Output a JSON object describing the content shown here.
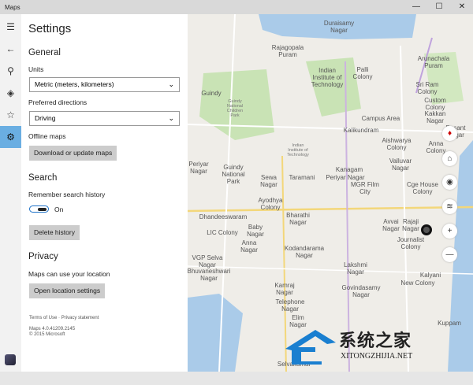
{
  "window": {
    "title": "Maps",
    "minimize": "—",
    "maximize": "☐",
    "close": "✕"
  },
  "rail": {
    "menu": "☰",
    "back": "←",
    "search": "⚲",
    "directions": "◈",
    "favorites": "☆",
    "settings": "⚙"
  },
  "settings": {
    "title": "Settings",
    "general": "General",
    "units_label": "Units",
    "units_value": "Metric (meters, kilometers)",
    "directions_label": "Preferred directions",
    "directions_value": "Driving",
    "offline_label": "Offline maps",
    "offline_button": "Download or update maps",
    "search": "Search",
    "history_label": "Remember search history",
    "history_state": "On",
    "delete_button": "Delete history",
    "privacy": "Privacy",
    "location_label": "Maps can use your location",
    "location_button": "Open location settings",
    "terms": "Terms of Use",
    "sep": "·",
    "privacy_statement": "Privacy statement",
    "version": "Maps 4.0.41209.2145",
    "copyright": "© 2015 Microsoft"
  },
  "map": {
    "labels": [
      "Duraisamy\nNagar",
      "Rajagopala\nPuram",
      "Indian\nInstitute of\nTechnology",
      "Guindy",
      "Palli\nColony",
      "Arunachala\nPuram",
      "Sri Ram\nColony",
      "Custom\nColony",
      "Kakkan\nNagar",
      "Besant\nNagar",
      "Anna\nColony",
      "Campus Area",
      "Kalikundram",
      "Aishwarya\nColony",
      "Valluvar\nNagar",
      "Kanagam",
      "Periyar Nagar",
      "MGR Film\nCity",
      "Taramani",
      "Sewa\nNagar",
      "Guindy\nNational\nPark",
      "Periyar\nNagar",
      "Ayodhya\nColony",
      "Dhandeeswaram",
      "Bharathi\nNagar",
      "Avvai\nNagar",
      "Rajaji\nNagar",
      "Baby\nNagar",
      "LIC Colony",
      "Anna\nNagar",
      "Kodandarama\nNagar",
      "VGP Selva\nNagar",
      "Bhuvaneshwari\nNagar",
      "Lakshmi\nNagar",
      "Journalist\nColony",
      "New Colony",
      "Kamraj\nNagar",
      "Telephone\nNagar",
      "Govindasamy\nNagar",
      "Elim\nNagar",
      "Kuppam",
      "Selvakumar",
      "Cge House\nColony",
      "Kalyani",
      "Guindy\nNational\nChildren\nPark",
      "Indian\nInstitute of\nTechnology"
    ],
    "compass": "compass",
    "tilt": "⌂",
    "locate": "◉",
    "layers": "≋",
    "zoom_in": "+",
    "zoom_out": "—"
  },
  "watermark": {
    "cn": "系统之家",
    "en": "XITONGZHIJIA.NET"
  }
}
